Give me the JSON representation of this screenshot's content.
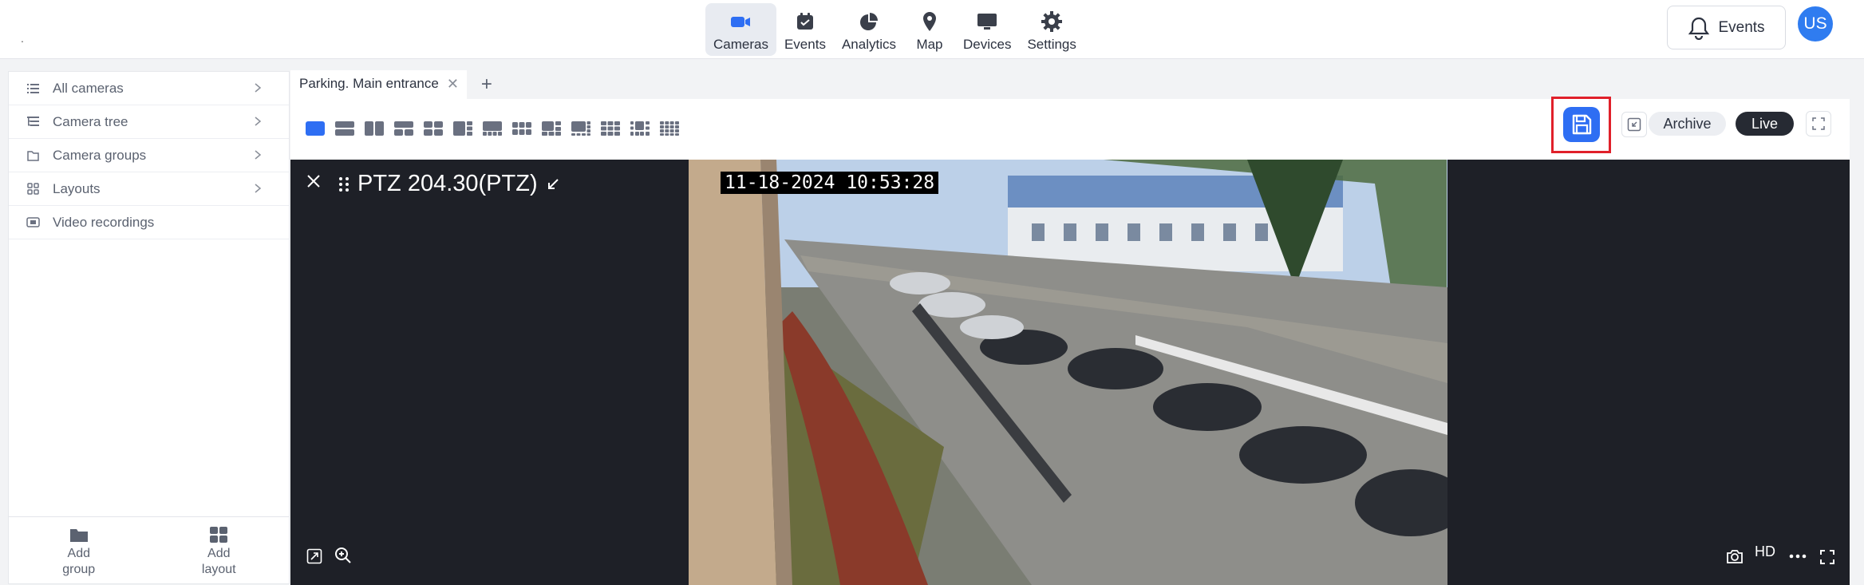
{
  "nav": {
    "items": [
      {
        "label": "Cameras",
        "icon": "camera-icon",
        "active": true
      },
      {
        "label": "Events",
        "icon": "calendar-icon",
        "active": false
      },
      {
        "label": "Analytics",
        "icon": "pie-chart-icon",
        "active": false
      },
      {
        "label": "Map",
        "icon": "map-pin-icon",
        "active": false
      },
      {
        "label": "Devices",
        "icon": "monitor-icon",
        "active": false
      },
      {
        "label": "Settings",
        "icon": "gear-icon",
        "active": false
      }
    ],
    "events_button": "Events",
    "avatar": "US",
    "corner_mark": "."
  },
  "sidebar": {
    "items": [
      {
        "label": "All cameras",
        "icon": "list-icon",
        "has_chevron": true
      },
      {
        "label": "Camera tree",
        "icon": "tree-icon",
        "has_chevron": true
      },
      {
        "label": "Camera groups",
        "icon": "folder-icon",
        "has_chevron": true
      },
      {
        "label": "Layouts",
        "icon": "grid-icon",
        "has_chevron": true
      },
      {
        "label": "Video recordings",
        "icon": "recordings-icon",
        "has_chevron": false
      }
    ],
    "add_group": [
      "Add",
      "group"
    ],
    "add_layout": [
      "Add",
      "layout"
    ]
  },
  "tabs": {
    "items": [
      {
        "label": "Parking. Main entrance"
      }
    ],
    "add": "+"
  },
  "toolbar": {
    "archive": "Archive",
    "live": "Live"
  },
  "viewer": {
    "camera_title": "PTZ 204.30(PTZ)",
    "timestamp": "11-18-2024 10:53:28",
    "quality": "HD"
  },
  "colors": {
    "accent": "#2e6ef3",
    "highlight": "#e0202a",
    "viewer_bg": "#1e2027",
    "avatar": "#2f7cf0"
  }
}
